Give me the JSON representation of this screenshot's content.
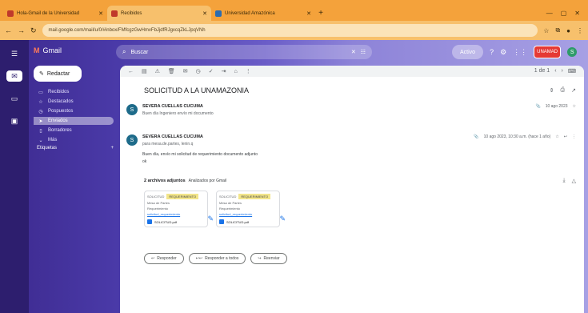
{
  "browser": {
    "tabs": [
      {
        "label": "Hola-Gmail de la Universidad",
        "active": false
      },
      {
        "label": "Recibidos",
        "active": true
      },
      {
        "label": "Universidad Amazónica",
        "active": false
      }
    ],
    "url": "mail.google.com/mail/u/0/#inbox/FMfcgzGwHmvFbJjdfRJgxcqZkLJpqVNh"
  },
  "gmail": {
    "logo": "Gmail",
    "search_placeholder": "Buscar",
    "status": "Activo",
    "account_badge": "UNAMAD",
    "avatar_initial": "S",
    "compose": "Redactar",
    "nav": [
      {
        "label": "Recibidos",
        "icon": "inbox-icon",
        "selected": false
      },
      {
        "label": "Destacados",
        "icon": "star-icon",
        "selected": false
      },
      {
        "label": "Pospuestos",
        "icon": "clock-icon",
        "selected": false
      },
      {
        "label": "Enviados",
        "icon": "send-icon",
        "selected": true
      },
      {
        "label": "Borradores",
        "icon": "draft-icon",
        "selected": false
      },
      {
        "label": "Más",
        "icon": "chevron-down-icon",
        "selected": false
      }
    ],
    "section_label": "Etiquetas",
    "pagination": "1 de 1"
  },
  "thread": {
    "subject": "SOLICITUD A LA UNAMAZONIA",
    "messages": [
      {
        "sender": "SEVERA CUELLAS CUCUMA",
        "snippet": "Buen día Ingeniero envío mi documento",
        "time": "10 ago 2023",
        "initial": "S"
      },
      {
        "sender": "SEVERA CUELLAS CUCUMA",
        "recipient": "para mesa.de.partes, lenin.q",
        "time": "10 ago 2023, 10:30 a.m. (hace 1 año)",
        "line1": "Buen día, envío mi solicitud de requerimiento documento adjunto",
        "line2": "ok",
        "initial": "S"
      }
    ],
    "attachments_title": "2 archivos adjuntos",
    "attachments_scan": "Analizados por Gmail",
    "attachments": [
      {
        "tag": "SOLICITUD",
        "hl": "REQUERIMIENTO",
        "line1": "Mesa de Partes",
        "line2": "Requerimiento",
        "link": "solicitud_requerimiento",
        "file": "SOLICITUD.pdf"
      },
      {
        "tag": "SOLICITUD",
        "hl": "REQUERIMIENTO",
        "line1": "Mesa de Partes",
        "line2": "Requerimiento",
        "link": "solicitud_requerimiento",
        "file": "SOLICITUD.pdf"
      }
    ],
    "actions": {
      "reply": "Responder",
      "reply_all": "Responder a todos",
      "forward": "Reenviar"
    }
  }
}
